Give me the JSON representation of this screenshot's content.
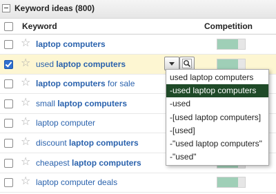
{
  "panel": {
    "title": "Keyword ideas (800)"
  },
  "columns": {
    "keyword": "Keyword",
    "competition": "Competition"
  },
  "rows": [
    {
      "parts": [
        {
          "t": "laptop computers",
          "b": true
        }
      ],
      "checked": false,
      "competition": 0.75
    },
    {
      "parts": [
        {
          "t": "used ",
          "b": false
        },
        {
          "t": "laptop computers",
          "b": true
        }
      ],
      "checked": true,
      "competition": 0.75
    },
    {
      "parts": [
        {
          "t": "laptop computers",
          "b": true
        },
        {
          "t": " for sale",
          "b": false
        }
      ],
      "checked": false,
      "competition": 0.75
    },
    {
      "parts": [
        {
          "t": "small ",
          "b": false
        },
        {
          "t": "laptop computers",
          "b": true
        }
      ],
      "checked": false,
      "competition": 0.75
    },
    {
      "parts": [
        {
          "t": "laptop computer",
          "b": false
        }
      ],
      "checked": false,
      "competition": 0.75
    },
    {
      "parts": [
        {
          "t": "discount ",
          "b": false
        },
        {
          "t": "laptop computers",
          "b": true
        }
      ],
      "checked": false,
      "competition": 0.75
    },
    {
      "parts": [
        {
          "t": "cheapest ",
          "b": false
        },
        {
          "t": "laptop computers",
          "b": true
        }
      ],
      "checked": false,
      "competition": 0.75
    },
    {
      "parts": [
        {
          "t": "laptop computer deals",
          "b": false
        }
      ],
      "checked": false,
      "competition": 0.75
    }
  ],
  "dropdown": {
    "items": [
      "used laptop computers",
      "-used laptop computers",
      "-used",
      "-[used laptop computers]",
      "-[used]",
      "-\"used laptop computers\"",
      "-\"used\""
    ],
    "selected_index": 1
  },
  "icons": {
    "collapse": "minus-square-icon",
    "star": "star-icon",
    "dropdown": "triangle-down-icon",
    "search": "magnifier-icon"
  },
  "colors": {
    "link": "#2a62ad",
    "competition_fill": "#9fcfb7",
    "row_highlight": "#fdf6d2",
    "menu_selected": "#1f4a28"
  }
}
